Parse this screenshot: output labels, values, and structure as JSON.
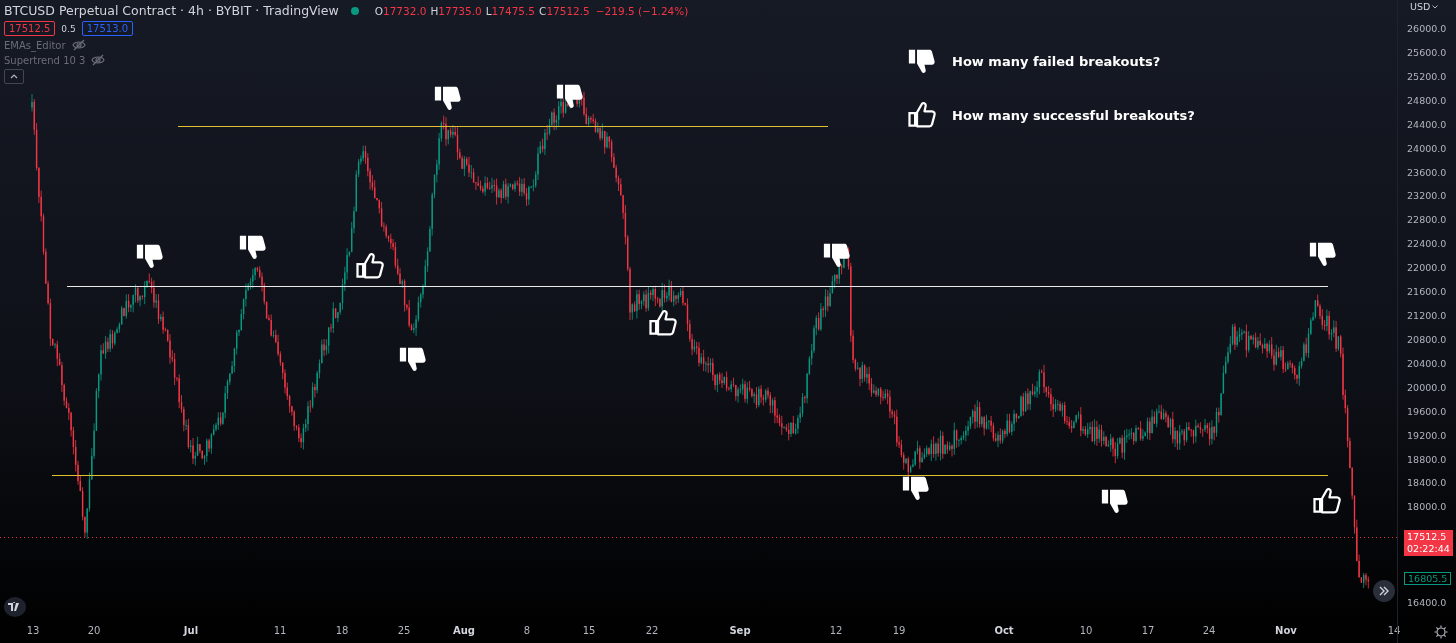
{
  "header": {
    "title": "BTCUSD Perpetual Contract · 4h · BYBIT · TradingView",
    "ohlc": [
      {
        "label": "O",
        "value": "17732.0"
      },
      {
        "label": "H",
        "value": "17735.0"
      },
      {
        "label": "L",
        "value": "17475.5"
      },
      {
        "label": "C",
        "value": "17512.5"
      }
    ],
    "change": "−219.5 (−1.24%)"
  },
  "quote": {
    "bid": "17512.5",
    "spread": "0.5",
    "ask": "17513.0"
  },
  "indicators": [
    {
      "name": "EMAs_Editor",
      "hidden": true
    },
    {
      "name": "Supertrend 10 3",
      "hidden": true
    }
  ],
  "legend": [
    {
      "kind": "failed",
      "text": "How many failed breakouts?"
    },
    {
      "kind": "successful",
      "text": "How many successful breakouts?"
    }
  ],
  "markers": [
    {
      "kind": "failed"
    },
    {
      "kind": "failed"
    },
    {
      "kind": "successful"
    },
    {
      "kind": "failed"
    },
    {
      "kind": "failed"
    },
    {
      "kind": "failed"
    },
    {
      "kind": "successful"
    },
    {
      "kind": "failed"
    },
    {
      "kind": "failed"
    },
    {
      "kind": "failed"
    },
    {
      "kind": "failed"
    },
    {
      "kind": "successful"
    }
  ],
  "price_axis": {
    "currency": "USD",
    "ticks": [
      "26000.0",
      "25600.0",
      "25200.0",
      "24800.0",
      "24400.0",
      "24000.0",
      "23600.0",
      "23200.0",
      "22800.0",
      "22400.0",
      "22000.0",
      "21600.0",
      "21200.0",
      "20800.0",
      "20400.0",
      "20000.0",
      "19600.0",
      "19200.0",
      "18800.0",
      "18400.0",
      "18000.0",
      "16400.0"
    ],
    "last_price": "17512.5",
    "countdown": "02:22:44",
    "marker_price": "16805.5"
  },
  "time_axis": [
    {
      "label": "13",
      "kind": "day"
    },
    {
      "label": "20",
      "kind": "day"
    },
    {
      "label": "Jul",
      "kind": "month"
    },
    {
      "label": "11",
      "kind": "day"
    },
    {
      "label": "18",
      "kind": "day"
    },
    {
      "label": "25",
      "kind": "day"
    },
    {
      "label": "Aug",
      "kind": "month"
    },
    {
      "label": "8",
      "kind": "day"
    },
    {
      "label": "15",
      "kind": "day"
    },
    {
      "label": "22",
      "kind": "day"
    },
    {
      "label": "Sep",
      "kind": "month"
    },
    {
      "label": "12",
      "kind": "day"
    },
    {
      "label": "19",
      "kind": "day"
    },
    {
      "label": "Oct",
      "kind": "month"
    },
    {
      "label": "10",
      "kind": "day"
    },
    {
      "label": "17",
      "kind": "day"
    },
    {
      "label": "24",
      "kind": "day"
    },
    {
      "label": "Nov",
      "kind": "month"
    },
    {
      "label": "14",
      "kind": "day"
    }
  ]
}
